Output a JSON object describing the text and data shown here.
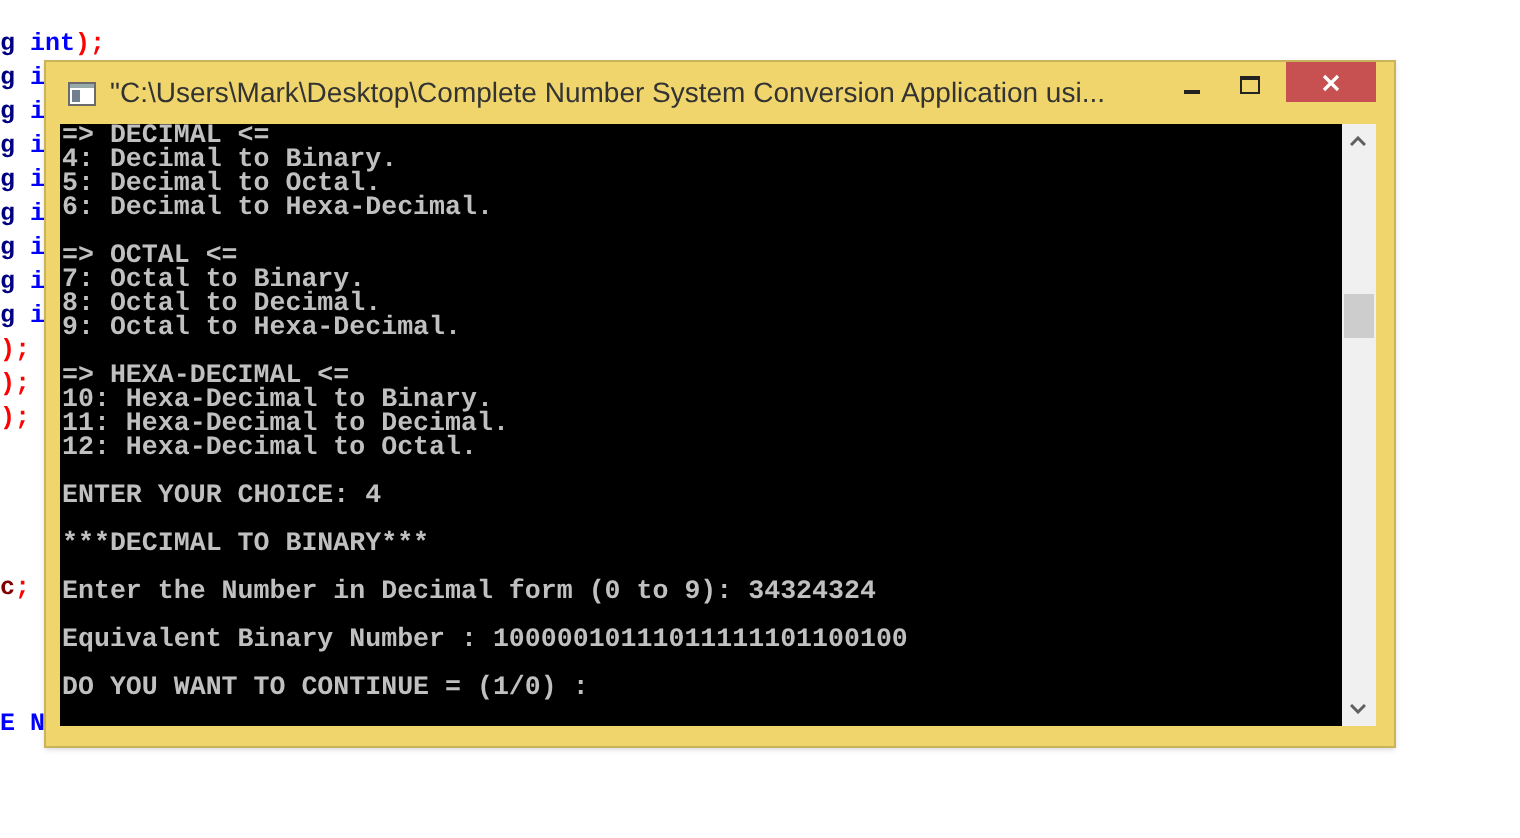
{
  "editor": {
    "groups": [
      {
        "lines": [
          {
            "segments": [
              {
                "text": "g ",
                "color": "#000080"
              },
              {
                "text": "int",
                "color": "#0000ff"
              },
              {
                "text": ");",
                "color": "#ff0000"
              }
            ]
          },
          {
            "segments": [
              {
                "text": "g ",
                "color": "#000080"
              },
              {
                "text": "i",
                "color": "#0000ff"
              }
            ]
          },
          {
            "segments": [
              {
                "text": "g ",
                "color": "#000080"
              },
              {
                "text": "i",
                "color": "#0000ff"
              }
            ]
          },
          {
            "segments": [
              {
                "text": "g ",
                "color": "#000080"
              },
              {
                "text": "i",
                "color": "#0000ff"
              }
            ]
          },
          {
            "segments": [
              {
                "text": "g ",
                "color": "#000080"
              },
              {
                "text": "i",
                "color": "#0000ff"
              }
            ]
          },
          {
            "segments": [
              {
                "text": "g ",
                "color": "#000080"
              },
              {
                "text": "i",
                "color": "#0000ff"
              }
            ]
          },
          {
            "segments": [
              {
                "text": "g ",
                "color": "#000080"
              },
              {
                "text": "i",
                "color": "#0000ff"
              }
            ]
          },
          {
            "segments": [
              {
                "text": "g ",
                "color": "#000080"
              },
              {
                "text": "i",
                "color": "#0000ff"
              }
            ]
          },
          {
            "segments": [
              {
                "text": "g ",
                "color": "#000080"
              },
              {
                "text": "i",
                "color": "#0000ff"
              }
            ]
          },
          {
            "segments": [
              {
                "text": ");",
                "color": "#ff0000"
              }
            ]
          },
          {
            "segments": [
              {
                "text": ");",
                "color": "#ff0000"
              }
            ]
          },
          {
            "segments": [
              {
                "text": ");",
                "color": "#ff0000"
              }
            ]
          }
        ]
      },
      {
        "lines": [
          {
            "segments": [
              {
                "text": "c",
                "color": "#800000"
              },
              {
                "text": ";",
                "color": "#ff0000"
              }
            ]
          }
        ]
      },
      {
        "lines": [
          {
            "segments": [
              {
                "text": "E N",
                "color": "#0000ff"
              }
            ]
          }
        ]
      }
    ]
  },
  "window": {
    "title": "\"C:\\Users\\Mark\\Desktop\\Complete Number System Conversion Application usi...",
    "console_blocks": [
      [
        "=> DECIMAL <=",
        "4: Decimal to Binary.",
        "5: Decimal to Octal.",
        "6: Decimal to Hexa-Decimal."
      ],
      [
        "=> OCTAL <=",
        "7: Octal to Binary.",
        "8: Octal to Decimal.",
        "9: Octal to Hexa-Decimal."
      ],
      [
        "=> HEXA-DECIMAL <=",
        "10: Hexa-Decimal to Binary.",
        "11: Hexa-Decimal to Decimal.",
        "12: Hexa-Decimal to Octal."
      ],
      [
        "ENTER YOUR CHOICE: 4"
      ],
      [
        "***DECIMAL TO BINARY***"
      ],
      [
        "Enter the Number in Decimal form (0 to 9): 34324324"
      ],
      [
        "Equivalent Binary Number : 10000010111011111101100100"
      ],
      [
        "DO YOU WANT TO CONTINUE = (1/0) :"
      ]
    ]
  }
}
